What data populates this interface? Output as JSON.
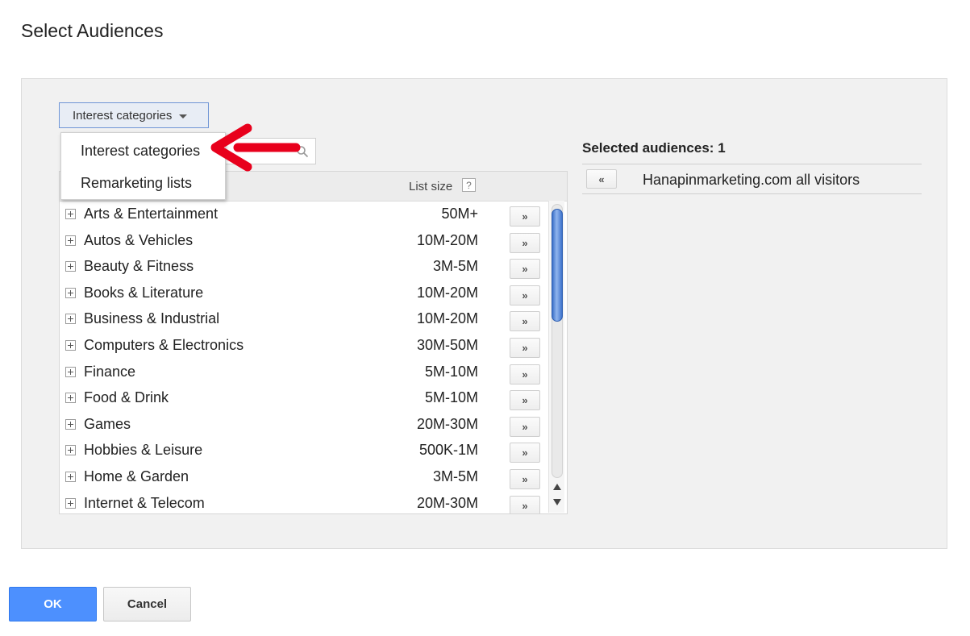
{
  "dialog": {
    "title": "Select Audiences"
  },
  "type_dropdown": {
    "label": "Interest categories"
  },
  "dropdown_menu": {
    "items": [
      "Interest categories",
      "Remarketing lists"
    ]
  },
  "list": {
    "column_header": "List size",
    "help_symbol": "?",
    "add_symbol": "»",
    "rows": [
      {
        "name": "Arts & Entertainment",
        "size": "50M+"
      },
      {
        "name": "Autos & Vehicles",
        "size": "10M-20M"
      },
      {
        "name": "Beauty & Fitness",
        "size": "3M-5M"
      },
      {
        "name": "Books & Literature",
        "size": "10M-20M"
      },
      {
        "name": "Business & Industrial",
        "size": "10M-20M"
      },
      {
        "name": "Computers & Electronics",
        "size": "30M-50M"
      },
      {
        "name": "Finance",
        "size": "5M-10M"
      },
      {
        "name": "Food & Drink",
        "size": "5M-10M"
      },
      {
        "name": "Games",
        "size": "20M-30M"
      },
      {
        "name": "Hobbies & Leisure",
        "size": "500K-1M"
      },
      {
        "name": "Home & Garden",
        "size": "3M-5M"
      },
      {
        "name": "Internet & Telecom",
        "size": "20M-30M"
      }
    ]
  },
  "selected": {
    "header_label": "Selected audiences:",
    "count": "1",
    "remove_symbol": "«",
    "items": [
      "Hanapinmarketing.com all visitors"
    ]
  },
  "buttons": {
    "ok": "OK",
    "cancel": "Cancel"
  },
  "colors": {
    "primary": "#4d90fe",
    "annotation_arrow": "#e8001c",
    "scroll_thumb": "#3b70c8"
  }
}
